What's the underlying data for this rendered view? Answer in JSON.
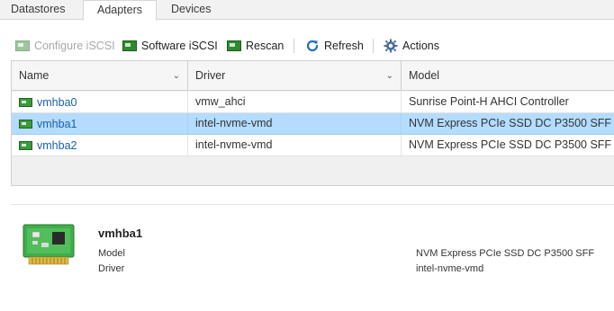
{
  "tabs": [
    {
      "label": "Datastores"
    },
    {
      "label": "Adapters"
    },
    {
      "label": "Devices"
    }
  ],
  "toolbar": {
    "configure": "Configure iSCSI",
    "software": "Software iSCSI",
    "rescan": "Rescan",
    "refresh": "Refresh",
    "actions": "Actions"
  },
  "grid": {
    "columns": [
      "Name",
      "Driver",
      "Model"
    ],
    "rows": [
      {
        "name": "vmhba0",
        "driver": "vmw_ahci",
        "model": "Sunrise Point-H AHCI Controller"
      },
      {
        "name": "vmhba1",
        "driver": "intel-nvme-vmd",
        "model": "NVM Express PCIe SSD DC P3500 SFF"
      },
      {
        "name": "vmhba2",
        "driver": "intel-nvme-vmd",
        "model": "NVM Express PCIe SSD DC P3500 SFF"
      }
    ],
    "selected_index": 1
  },
  "detail": {
    "title": "vmhba1",
    "model_label": "Model",
    "model_value": "NVM Express PCIe SSD DC P3500 SFF",
    "driver_label": "Driver",
    "driver_value": "intel-nvme-vmd"
  },
  "colors": {
    "selected_row": "#b4dcff",
    "link": "#1a5fa8",
    "adapter_icon": "#3c9a3c"
  }
}
